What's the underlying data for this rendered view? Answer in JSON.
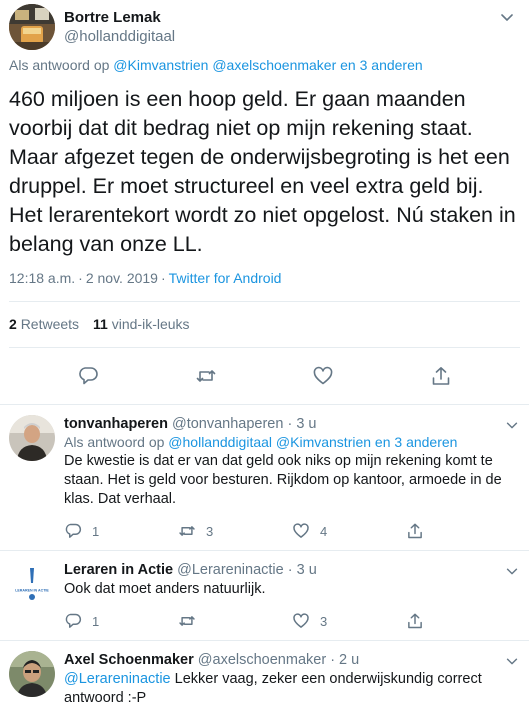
{
  "main_tweet": {
    "display_name": "Bortre Lemak",
    "handle": "@hollanddigitaal",
    "replying_prefix": "Als antwoord op",
    "replying_to": "@Kimvanstrien @axelschoenmaker en 3 anderen",
    "text": "460 miljoen is een hoop geld. Er gaan maanden voorbij dat dit bedrag niet op mijn rekening staat. Maar afgezet tegen de onderwijsbegroting is het een druppel. Er moet structureel en veel extra geld bij. Het lerarentekort wordt zo niet opgelost. Nú staken in belang van onze LL.",
    "time": "12:18 a.m.",
    "separator": "·",
    "date": "2 nov. 2019",
    "source": "Twitter for Android",
    "retweets_count": "2",
    "retweets_label": "Retweets",
    "likes_count": "11",
    "likes_label": "vind-ik-leuks"
  },
  "replies": [
    {
      "display_name": "tonvanhaperen",
      "handle": "@tonvanhaperen",
      "time": "· 3 u",
      "replying_prefix": "Als antwoord op",
      "replying_to": "@hollanddigitaal @Kimvanstrien en 3 anderen",
      "mention": "",
      "text": "De kwestie is dat er van dat geld ook niks op mijn rekening komt te staan. Het is geld voor besturen. Rijkdom op kantoor, armoede in de klas. Dat verhaal.",
      "reply_count": "1",
      "retweet_count": "3",
      "like_count": "4"
    },
    {
      "display_name": "Leraren in Actie",
      "handle": "@Lerareninactie",
      "time": "· 3 u",
      "replying_prefix": "",
      "replying_to": "",
      "mention": "",
      "text": "Ook dat moet anders natuurlijk.",
      "reply_count": "1",
      "retweet_count": "",
      "like_count": "3"
    },
    {
      "display_name": "Axel Schoenmaker",
      "handle": "@axelschoenmaker",
      "time": "· 2 u",
      "replying_prefix": "",
      "replying_to": "",
      "mention": "@Lerareninactie",
      "text": " Lekker vaag, zeker een onderwijskundig correct antwoord :-P",
      "reply_count": "",
      "retweet_count": "",
      "like_count": ""
    }
  ],
  "logo_text": "LERAREN IN ACTIE",
  "colors": {
    "link": "#1b95e0",
    "muted": "#657786",
    "text": "#14171a",
    "border": "#e6ecf0"
  },
  "icons": [
    "chevron-down-icon",
    "reply-icon",
    "retweet-icon",
    "like-icon",
    "share-icon"
  ]
}
